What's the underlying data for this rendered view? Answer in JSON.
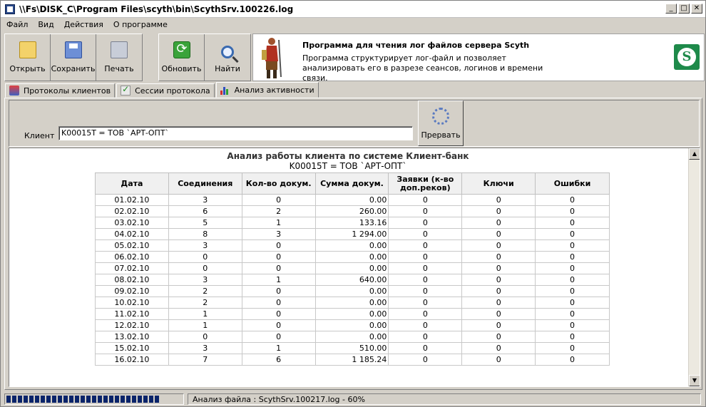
{
  "window": {
    "title": "\\\\Fs\\DISK_C\\Program Files\\scyth\\bin\\ScythSrv.100226.log",
    "controls": {
      "minimize": "_",
      "maximize": "□",
      "close": "✕"
    }
  },
  "menu": [
    "Файл",
    "Вид",
    "Действия",
    "О программе"
  ],
  "toolbar": {
    "open": "Открыть",
    "save": "Сохранить",
    "print": "Печать",
    "refresh": "Обновить",
    "find": "Найти"
  },
  "info": {
    "title": "Программа для чтения лог файлов сервера Scyth",
    "description": "Программа структурирует лог-файл и позволяет анализировать его в разрезе сеансов, логинов и времени связи."
  },
  "tabs": [
    {
      "label": "Протоколы клиентов",
      "icon": "clients-icon"
    },
    {
      "label": "Сессии протокола",
      "icon": "checklist-icon"
    },
    {
      "label": "Анализ активности",
      "icon": "bar-chart-icon",
      "active": true
    }
  ],
  "client": {
    "label": "Клиент",
    "value": "K00015T = ТОВ `АРТ-ОПТ`",
    "stop_button": "Прервать"
  },
  "report": {
    "title": "Анализ работы клиента по системе Клиент-банк",
    "subtitle": "K00015T = ТОВ `АРТ-ОПТ`",
    "columns": [
      "Дата",
      "Соединения",
      "Кол-во докум.",
      "Сумма докум.",
      "Заявки (к-во доп.реков)",
      "Ключи",
      "Ошибки"
    ],
    "rows": [
      [
        "01.02.10",
        "3",
        "0",
        "0.00",
        "0",
        "0",
        "0"
      ],
      [
        "02.02.10",
        "6",
        "2",
        "260.00",
        "0",
        "0",
        "0"
      ],
      [
        "03.02.10",
        "5",
        "1",
        "133.16",
        "0",
        "0",
        "0"
      ],
      [
        "04.02.10",
        "8",
        "3",
        "1 294.00",
        "0",
        "0",
        "0"
      ],
      [
        "05.02.10",
        "3",
        "0",
        "0.00",
        "0",
        "0",
        "0"
      ],
      [
        "06.02.10",
        "0",
        "0",
        "0.00",
        "0",
        "0",
        "0"
      ],
      [
        "07.02.10",
        "0",
        "0",
        "0.00",
        "0",
        "0",
        "0"
      ],
      [
        "08.02.10",
        "3",
        "1",
        "640.00",
        "0",
        "0",
        "0"
      ],
      [
        "09.02.10",
        "2",
        "0",
        "0.00",
        "0",
        "0",
        "0"
      ],
      [
        "10.02.10",
        "2",
        "0",
        "0.00",
        "0",
        "0",
        "0"
      ],
      [
        "11.02.10",
        "1",
        "0",
        "0.00",
        "0",
        "0",
        "0"
      ],
      [
        "12.02.10",
        "1",
        "0",
        "0.00",
        "0",
        "0",
        "0"
      ],
      [
        "13.02.10",
        "0",
        "0",
        "0.00",
        "0",
        "0",
        "0"
      ],
      [
        "15.02.10",
        "3",
        "1",
        "510.00",
        "0",
        "0",
        "0"
      ],
      [
        "16.02.10",
        "7",
        "6",
        "1 185.24",
        "0",
        "0",
        "0"
      ]
    ]
  },
  "status": {
    "text": "Анализ файла : ScythSrv.100217.log  -  60%",
    "progress": 0.88
  }
}
